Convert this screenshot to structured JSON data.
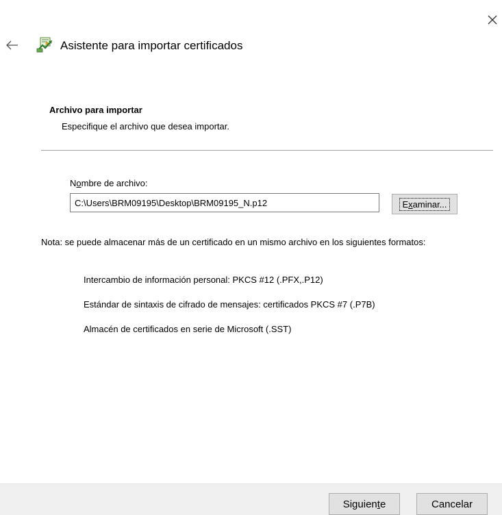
{
  "window": {
    "title": "Asistente para importar certificados",
    "close_icon": "close-icon",
    "back_icon": "back-arrow-icon",
    "wizard_icon": "certificate-wizard-icon"
  },
  "section": {
    "heading": "Archivo para importar",
    "subtitle": "Especifique el archivo que desea importar."
  },
  "file": {
    "label_pre": "N",
    "label_accel": "o",
    "label_post": "mbre de archivo:",
    "value": "C:\\Users\\BRM09195\\Desktop\\BRM09195_N.p12",
    "browse_pre": "E",
    "browse_accel": "x",
    "browse_post": "aminar..."
  },
  "note": {
    "text": "Nota: se puede almacenar más de un certificado en un mismo archivo en los siguientes formatos:",
    "formats": [
      "Intercambio de información personal: PKCS #12 (.PFX,.P12)",
      "Estándar de sintaxis de cifrado de mensajes: certificados PKCS #7 (.P7B)",
      "Almacén de certificados en serie de Microsoft (.SST)"
    ]
  },
  "footer": {
    "next_pre": "Siguien",
    "next_accel": "t",
    "next_post": "e",
    "cancel_label": "Cancelar"
  }
}
